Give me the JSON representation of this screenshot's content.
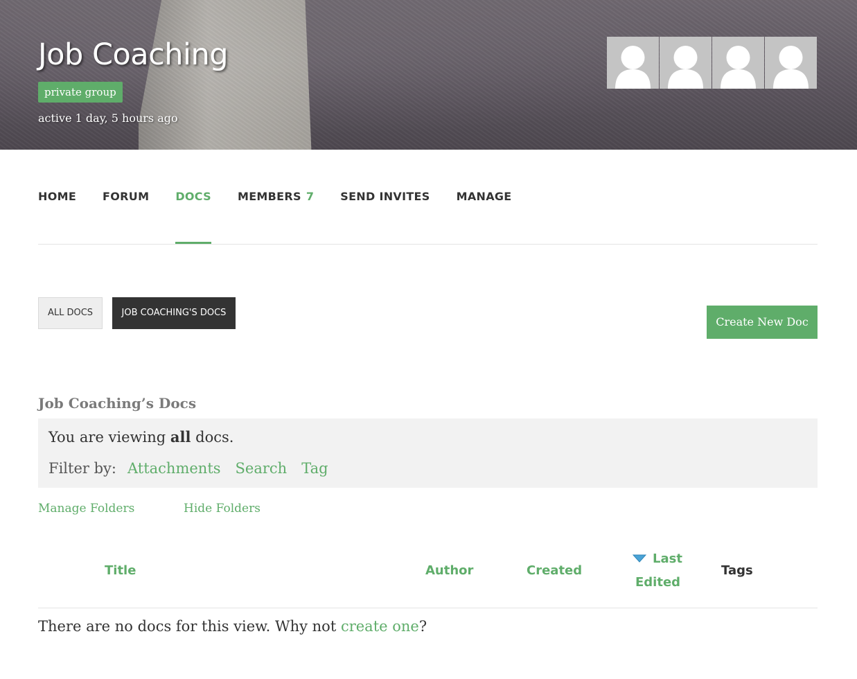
{
  "header": {
    "title": "Job Coaching",
    "group_type": "private group",
    "activity": "active 1 day, 5 hours ago",
    "avatars": [
      "member-avatar",
      "member-avatar",
      "member-avatar",
      "member-avatar"
    ]
  },
  "nav": {
    "items": [
      {
        "label": "HOME"
      },
      {
        "label": "FORUM"
      },
      {
        "label": "DOCS"
      },
      {
        "label": "MEMBERS",
        "count": "7"
      },
      {
        "label": "SEND INVITES"
      },
      {
        "label": "MANAGE"
      }
    ],
    "active": "DOCS"
  },
  "docs_toolbar": {
    "all_docs": "ALL DOCS",
    "group_docs": "JOB COACHING'S DOCS",
    "create": "Create New Doc"
  },
  "docs": {
    "heading": "Job Coaching’s Docs",
    "viewing_prefix": "You are viewing ",
    "viewing_bold": "all",
    "viewing_suffix": " docs.",
    "filter_label": "Filter by:",
    "filters": [
      "Attachments",
      "Search",
      "Tag"
    ],
    "manage_folders": "Manage Folders",
    "hide_folders": "Hide Folders"
  },
  "table": {
    "columns": {
      "title": "Title",
      "author": "Author",
      "created": "Created",
      "last_edited_1": "Last",
      "last_edited_2": "Edited",
      "tags": "Tags"
    },
    "sort_icon": "sort-descending-icon",
    "empty_prefix": "There are no docs for this view. Why not ",
    "empty_link": "create one",
    "empty_suffix": "?"
  },
  "colors": {
    "accent": "#5fad6a",
    "dark_button": "#333333",
    "info_box": "#f2f2f2"
  }
}
